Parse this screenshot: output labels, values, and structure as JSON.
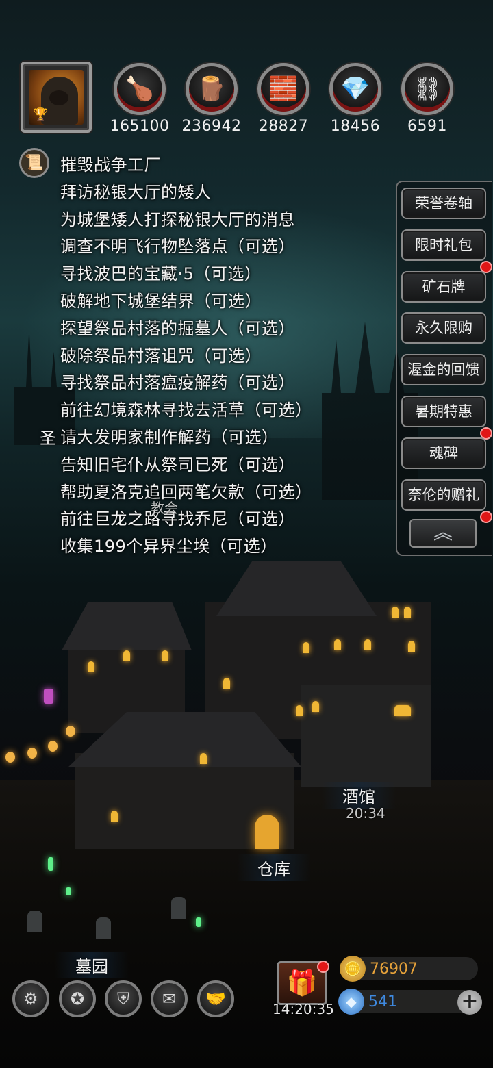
{
  "resources": [
    {
      "name": "meat-icon",
      "glyph": "🍗",
      "value": "165100"
    },
    {
      "name": "wood-icon",
      "glyph": "🪵",
      "value": "236942"
    },
    {
      "name": "stone-icon",
      "glyph": "🧱",
      "value": "28827"
    },
    {
      "name": "crystal-icon",
      "glyph": "💎",
      "value": "18456"
    },
    {
      "name": "iron-icon",
      "glyph": "⛓",
      "value": "6591"
    }
  ],
  "quests": [
    "摧毁战争工厂",
    "拜访秘银大厅的矮人",
    "为城堡矮人打探秘银大厅的消息",
    "调查不明飞行物坠落点（可选）",
    "寻找波巴的宝藏·5（可选）",
    "破解地下城堡结界（可选）",
    "探望祭品村落的掘墓人（可选）",
    "破除祭品村落诅咒（可选）",
    "寻找祭品村落瘟疫解药（可选）",
    "前往幻境森林寻找去活草（可选）",
    "请大发明家制作解药（可选）",
    "告知旧宅仆从祭司已死（可选）",
    "帮助夏洛克追回两笔欠款（可选）",
    "前往巨龙之路寻找乔尼（可选）",
    "收集199个异界尘埃（可选）"
  ],
  "quest_prefix": "圣",
  "overlay_label": "教会",
  "side_menu": [
    {
      "label": "荣誉卷轴",
      "dot": false
    },
    {
      "label": "限时礼包",
      "dot": true
    },
    {
      "label": "矿石牌",
      "dot": false
    },
    {
      "label": "永久限购",
      "dot": false
    },
    {
      "label": "渥金的回馈",
      "dot": false
    },
    {
      "label": "暑期特惠",
      "dot": true
    },
    {
      "label": "魂碑",
      "dot": false
    },
    {
      "label": "奈伦的赠礼",
      "dot": true
    }
  ],
  "collapse_glyph": "︽",
  "buildings": {
    "tavern": {
      "label": "酒馆",
      "time": "20:34"
    },
    "warehouse": {
      "label": "仓库"
    },
    "graveyard": {
      "label": "墓园"
    }
  },
  "bottom_buttons": [
    {
      "name": "settings-button",
      "glyph": "⚙"
    },
    {
      "name": "achievement-button",
      "glyph": "✪"
    },
    {
      "name": "guild-button",
      "glyph": "⛨"
    },
    {
      "name": "mail-button",
      "glyph": "✉"
    },
    {
      "name": "handshake-button",
      "glyph": "🤝"
    }
  ],
  "gift": {
    "glyph": "🎁",
    "time": "14:20:35"
  },
  "currency": {
    "gold": {
      "glyph": "🪙",
      "value": "76907",
      "color": "#e6a23a"
    },
    "gem": {
      "glyph": "◆",
      "value": "541",
      "color": "#3f8ae0"
    }
  },
  "plus_glyph": "+",
  "colors": {
    "alert_red": "#e01616",
    "gold_text": "#e6a23a",
    "gem_text": "#3f8ae0"
  }
}
